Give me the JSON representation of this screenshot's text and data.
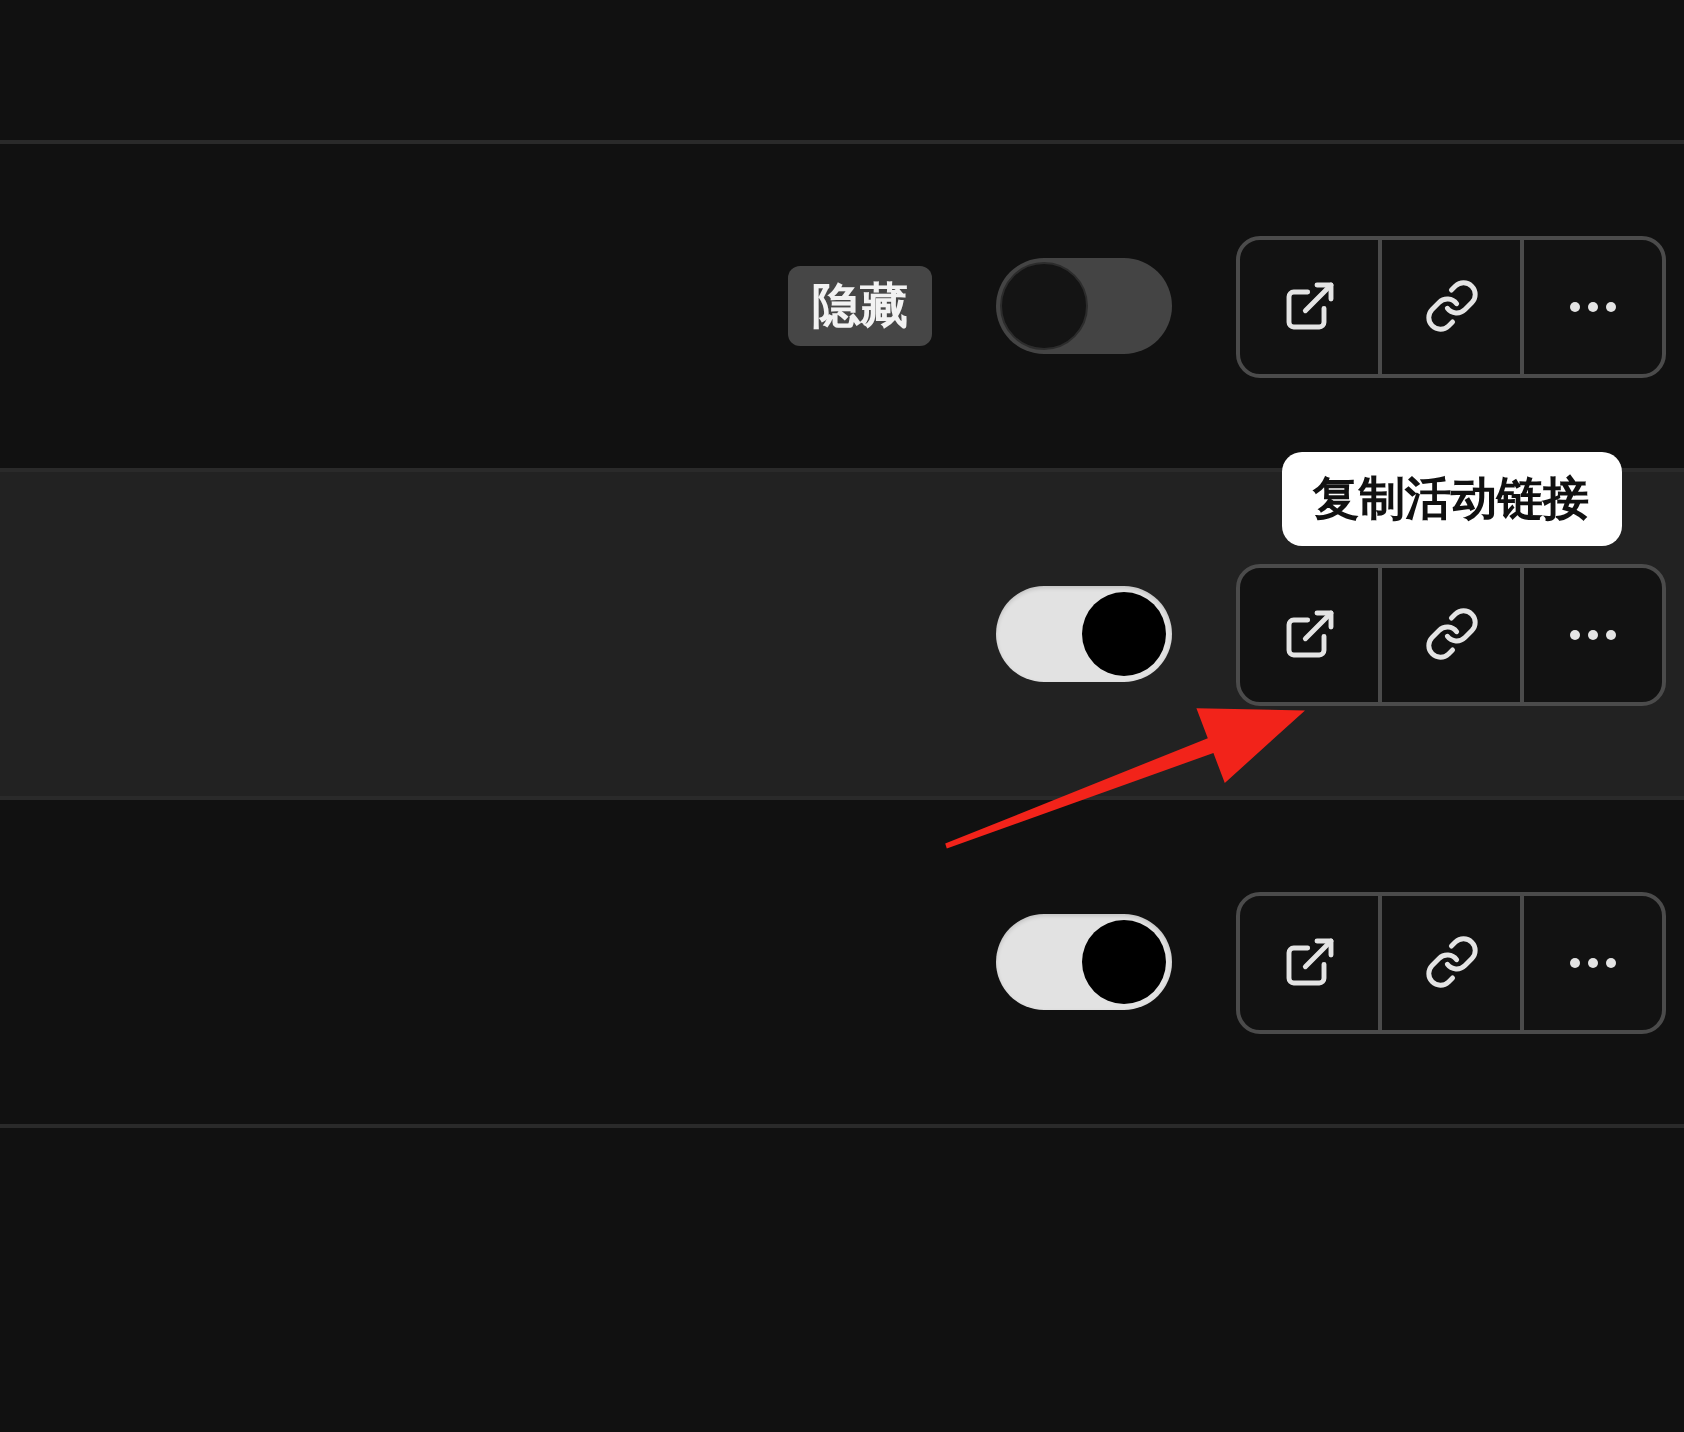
{
  "rows": [
    {
      "hovered": false,
      "tag": "隐藏",
      "on": false,
      "actions": [
        {
          "kind": "external"
        },
        {
          "kind": "link"
        },
        {
          "kind": "more"
        }
      ]
    },
    {
      "hovered": true,
      "on": true,
      "actions": [
        {
          "kind": "external"
        },
        {
          "kind": "link",
          "tooltip": "复制活动链接"
        },
        {
          "kind": "more"
        }
      ]
    },
    {
      "hovered": false,
      "on": true,
      "actions": [
        {
          "kind": "external"
        },
        {
          "kind": "link"
        },
        {
          "kind": "more"
        }
      ]
    }
  ],
  "annotations": [
    {
      "kind": "arrow"
    }
  ]
}
